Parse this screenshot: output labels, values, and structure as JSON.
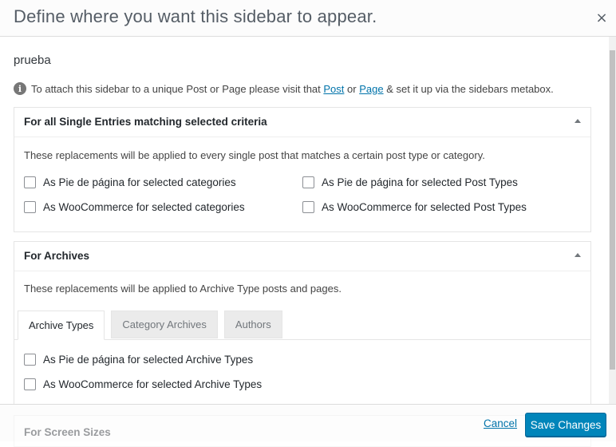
{
  "dialog": {
    "title": "Define where you want this sidebar to appear.",
    "close_symbol": "×",
    "sidebar_name": "prueba"
  },
  "info": {
    "icon": "info-icon",
    "text_before": "To attach this sidebar to a unique Post or Page please visit that ",
    "link_post": "Post",
    "text_or": " or ",
    "link_page": "Page",
    "text_after": " & set it up via the sidebars metabox."
  },
  "single_entries": {
    "title": "For all Single Entries matching selected criteria",
    "description": "These replacements will be applied to every single post that matches a certain post type or category.",
    "options": [
      "As Pie de página for selected categories",
      "As Pie de página for selected Post Types",
      "As WooCommerce for selected categories",
      "As WooCommerce for selected Post Types"
    ]
  },
  "archives": {
    "title": "For Archives",
    "description": "These replacements will be applied to Archive Type posts and pages.",
    "tabs": [
      "Archive Types",
      "Category Archives",
      "Authors"
    ],
    "active_tab": "Archive Types",
    "options": [
      "As Pie de página for selected Archive Types",
      "As WooCommerce for selected Archive Types"
    ]
  },
  "screen_sizes": {
    "title": "For Screen Sizes"
  },
  "footer": {
    "cancel_label": "Cancel",
    "save_label": "Save Changes"
  },
  "colors": {
    "primary_button": "#0085ba",
    "link": "#0073aa"
  }
}
